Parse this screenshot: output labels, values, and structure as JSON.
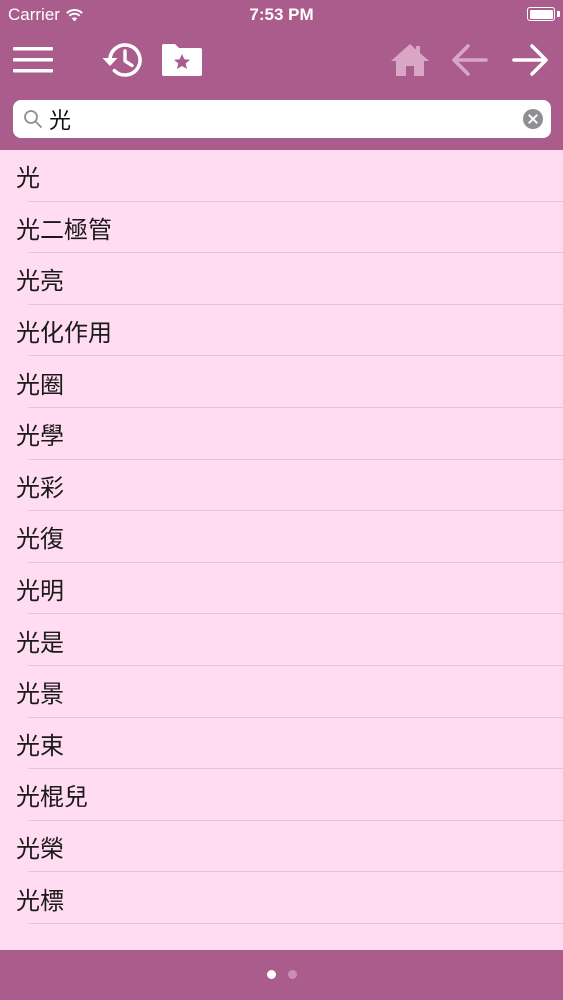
{
  "status_bar": {
    "carrier": "Carrier",
    "time": "7:53 PM",
    "battery_level": 1.0
  },
  "toolbar": {
    "menu_icon": "hamburger-menu-icon",
    "history_icon": "history-clock-icon",
    "favorites_icon": "star-folder-icon",
    "home_icon": "home-icon",
    "back_icon": "arrow-left-icon",
    "forward_icon": "arrow-right-icon"
  },
  "search": {
    "value": "光",
    "placeholder": ""
  },
  "results": [
    "光",
    "光二極管",
    "光亮",
    "光化作用",
    "光圈",
    "光學",
    "光彩",
    "光復",
    "光明",
    "光是",
    "光景",
    "光束",
    "光棍兒",
    "光榮",
    "光標"
  ],
  "pager": {
    "total": 2,
    "current": 1
  },
  "colors": {
    "header": "#aa5c8c",
    "list_background": "#ffdcf1",
    "separator": "#e9c2d8",
    "icon_active": "#ffffff",
    "icon_disabled": "#d9a6c6"
  }
}
